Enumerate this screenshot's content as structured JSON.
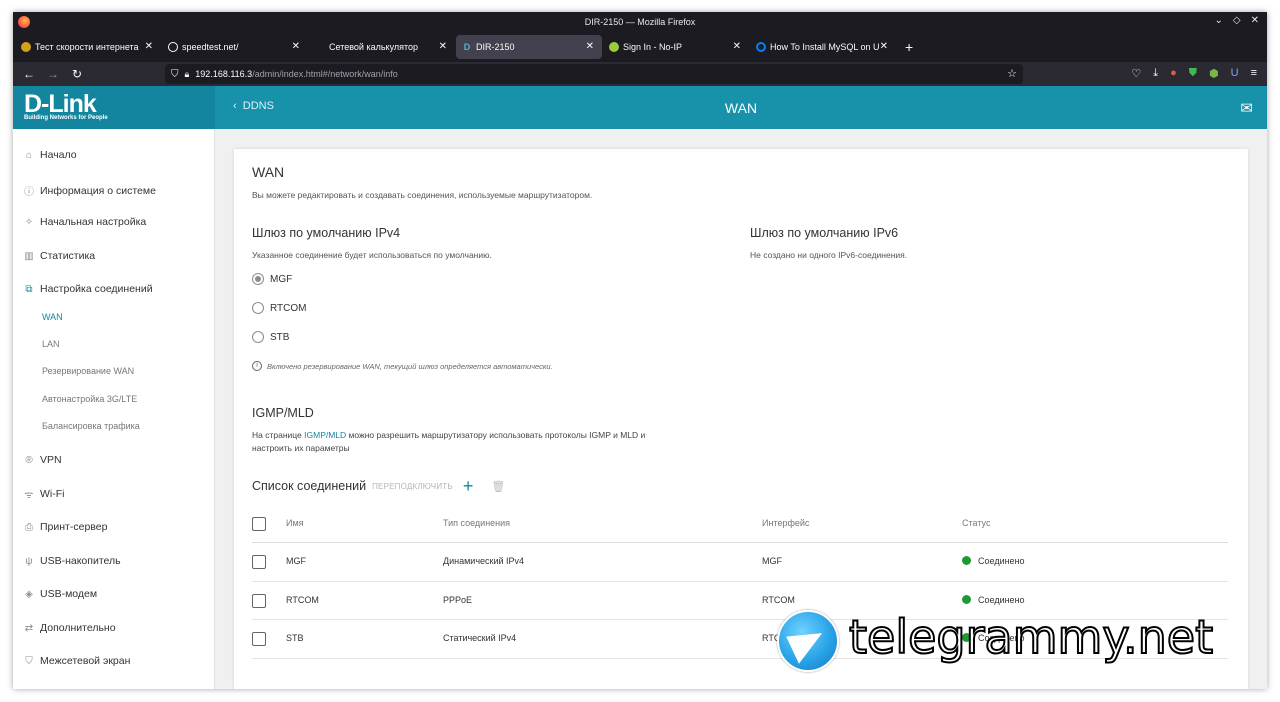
{
  "window": {
    "title": "DIR-2150 — Mozilla Firefox"
  },
  "tabs": [
    {
      "label": "Тест скорости интернета",
      "icon": "speedometer-icon",
      "active": false
    },
    {
      "label": "speedtest.net/",
      "icon": "speedtest-icon",
      "active": false
    },
    {
      "label": "Сетевой калькулятор",
      "icon": "",
      "active": false
    },
    {
      "label": "DIR-2150",
      "icon": "dlink-favicon",
      "active": true
    },
    {
      "label": "Sign In - No-IP",
      "icon": "noip-icon",
      "active": false
    },
    {
      "label": "How To Install MySQL on U",
      "icon": "digitalocean-icon",
      "active": false
    }
  ],
  "nav": {
    "url_host": "192.168.116.3",
    "url_path": "/admin/index.html#/network/wan/info"
  },
  "header": {
    "logo": "D-Link",
    "tagline": "Building Networks for People",
    "back_label": "DDNS",
    "page_title": "WAN"
  },
  "sidebar": {
    "items": [
      {
        "label": "Начало",
        "icon": "home-icon"
      },
      {
        "label": "Информация о системе",
        "icon": "info-icon"
      },
      {
        "label": "Начальная настройка",
        "icon": "wizard-icon"
      },
      {
        "label": "Статистика",
        "icon": "chart-icon"
      },
      {
        "label": "Настройка соединений",
        "icon": "connections-icon"
      },
      {
        "label": "VPN",
        "icon": "vpn-icon"
      },
      {
        "label": "Wi-Fi",
        "icon": "wifi-icon"
      },
      {
        "label": "Принт-сервер",
        "icon": "printer-icon"
      },
      {
        "label": "USB-накопитель",
        "icon": "usb-icon"
      },
      {
        "label": "USB-модем",
        "icon": "modem-icon"
      },
      {
        "label": "Дополнительно",
        "icon": "settings-icon"
      },
      {
        "label": "Межсетевой экран",
        "icon": "shield-icon"
      }
    ],
    "subitems": [
      {
        "label": "WAN",
        "active": true
      },
      {
        "label": "LAN",
        "active": false
      },
      {
        "label": "Резервирование WAN",
        "active": false
      },
      {
        "label": "Автонастройка 3G/LTE",
        "active": false
      },
      {
        "label": "Балансировка трафика",
        "active": false
      }
    ]
  },
  "wan": {
    "title": "WAN",
    "description": "Вы можете редактировать и создавать соединения, используемые маршрутизатором.",
    "ipv4_title": "Шлюз по умолчанию IPv4",
    "ipv4_desc": "Указанное соединение будет использоваться по умолчанию.",
    "ipv6_title": "Шлюз по умолчанию IPv6",
    "ipv6_desc": "Не создано ни одного IPv6-соединения.",
    "gateways": [
      {
        "label": "MGF",
        "selected": true
      },
      {
        "label": "RTCOM",
        "selected": false
      },
      {
        "label": "STB",
        "selected": false
      }
    ],
    "note": "Включено резервирование WAN, текущий шлюз определяется автоматически."
  },
  "igmp": {
    "title": "IGMP/MLD",
    "text_before": "На странице ",
    "link": "IGMP/MLD",
    "text_after": " можно разрешить маршрутизатору использовать протоколы IGMP и MLD и",
    "text_line2": "настроить их параметры"
  },
  "connections": {
    "title": "Список соединений",
    "reconnect_label": "ПЕРЕПОДКЛЮЧИТЬ",
    "columns": [
      "Имя",
      "Тип соединения",
      "Интерфейс",
      "Статус"
    ],
    "rows": [
      {
        "name": "MGF",
        "type": "Динамический IPv4",
        "interface": "MGF",
        "status": "Соединено"
      },
      {
        "name": "RTCOM",
        "type": "PPPoE",
        "interface": "RTCOM",
        "status": "Соединено"
      },
      {
        "name": "STB",
        "type": "Статический IPv4",
        "interface": "RTC",
        "status": "Соединено"
      }
    ],
    "status_color": "#1f9a32"
  },
  "watermark": {
    "text": "telegrammy.net"
  },
  "colors": {
    "accent": "#14859e",
    "topbar": "#1891ab"
  }
}
